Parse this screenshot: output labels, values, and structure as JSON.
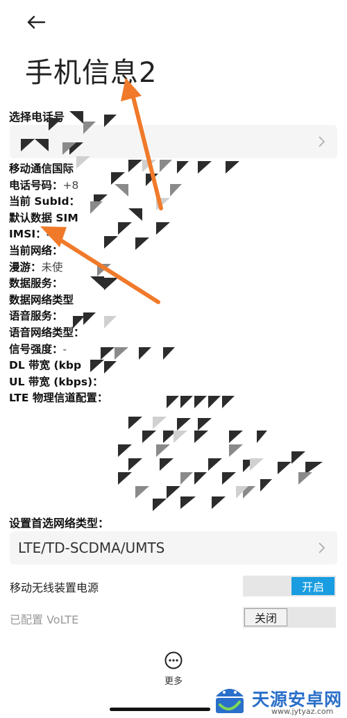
{
  "header": {
    "title": "手机信息2"
  },
  "phone_select": {
    "label": "选择电话号"
  },
  "info_rows": [
    {
      "label": "移动通信国际",
      "value": ""
    },
    {
      "label": "电话号码：",
      "value": "+8"
    },
    {
      "label": "当前 SubId：",
      "value": ""
    },
    {
      "label": "默认数据 SIM",
      "value": ""
    },
    {
      "label": "IMSI：",
      "value": "4"
    },
    {
      "label": "当前网络：",
      "value": ""
    },
    {
      "label": "漫游：",
      "value": "未使"
    },
    {
      "label": "数据服务：",
      "value": ""
    },
    {
      "label": "数据网络类型",
      "value": ""
    },
    {
      "label": "语音服务：",
      "value": ""
    },
    {
      "label": "语音网络类型：",
      "value": ""
    },
    {
      "label": "信号强度：",
      "value": "-"
    },
    {
      "label": "DL 带宽 (kbp",
      "value": ""
    },
    {
      "label": "UL 带宽 (kbps)：",
      "value": ""
    },
    {
      "label": "LTE 物理信道配置：",
      "value": ""
    }
  ],
  "network_type": {
    "label": "设置首选网络类型：",
    "value": "LTE/TD-SCDMA/UMTS"
  },
  "toggles": [
    {
      "label": "移动无线装置电源",
      "state": "开启",
      "on": true
    },
    {
      "label": "已配置 VoLTE",
      "state": "关闭",
      "on": false
    }
  ],
  "more": {
    "label": "更多"
  },
  "watermark": {
    "name": "天源安卓网",
    "url": "www.jytyaz.com"
  },
  "colors": {
    "accent": "#1a9de0",
    "annotation_arrow": "#f07a2a",
    "watermark": "#2a6fc9"
  },
  "icons": {
    "back": "arrow-left-icon",
    "chevron": "chevron-right-icon",
    "more": "more-horizontal-icon"
  }
}
